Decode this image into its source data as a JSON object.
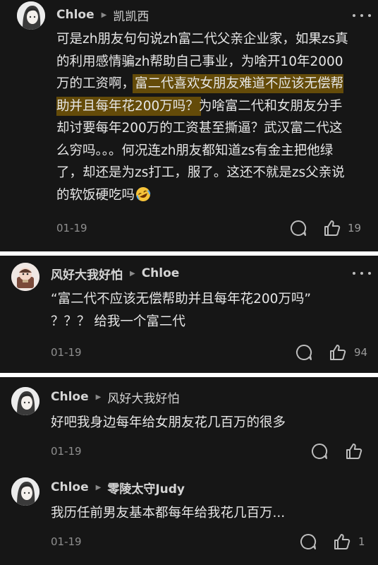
{
  "comments": [
    {
      "author": "Chloe",
      "reply_to": "凯凯西",
      "text_before": "可是zh朋友句句说zh富二代父亲企业家，如果zs真\n的利用感情骗zh帮助自己事业，为啥开10年2000\n万的工资啊，",
      "text_highlight": "富二代喜欢女朋友难道不应该无偿帮\n助并且每年花200万吗？",
      "text_after": "为啥富二代和女朋友分手\n却讨要每年200万的工资甚至撕逼？武汉富二代这\n么穷吗。。。何况连zh朋友都知道zs有金主把他绿\n了，却还是为zs打工，服了。这还不就是zs父亲说\n的软饭硬吃吗",
      "emoji": "rofl-emoji",
      "date": "01-19",
      "likes": "19"
    },
    {
      "author": "风好大我好怕",
      "reply_to": "Chloe",
      "text": "“富二代不应该无偿帮助并且每年花200万吗”\n？？？ 给我一个富二代",
      "date": "01-19",
      "likes": "94"
    },
    {
      "author": "Chloe",
      "reply_to": "风好大我好怕",
      "text": "好吧我身边每年给女朋友花几百万的很多",
      "date": "01-19",
      "likes": ""
    },
    {
      "author": "Chloe",
      "reply_to": "零陵太守Judy",
      "text": "我历任前男友基本都每年给我花几百万...",
      "date": "01-19",
      "likes": "1"
    }
  ],
  "icons": {
    "reply": "comment-bubble-icon",
    "like": "thumbs-up-icon",
    "more": "more-dots-icon",
    "arrow": "triangle-right-icon"
  },
  "colors": {
    "card_bg": "#161616",
    "separator": "#ffffff",
    "highlight": "#a67800",
    "text": "#e6e6e6",
    "meta": "#8f8f8f"
  }
}
